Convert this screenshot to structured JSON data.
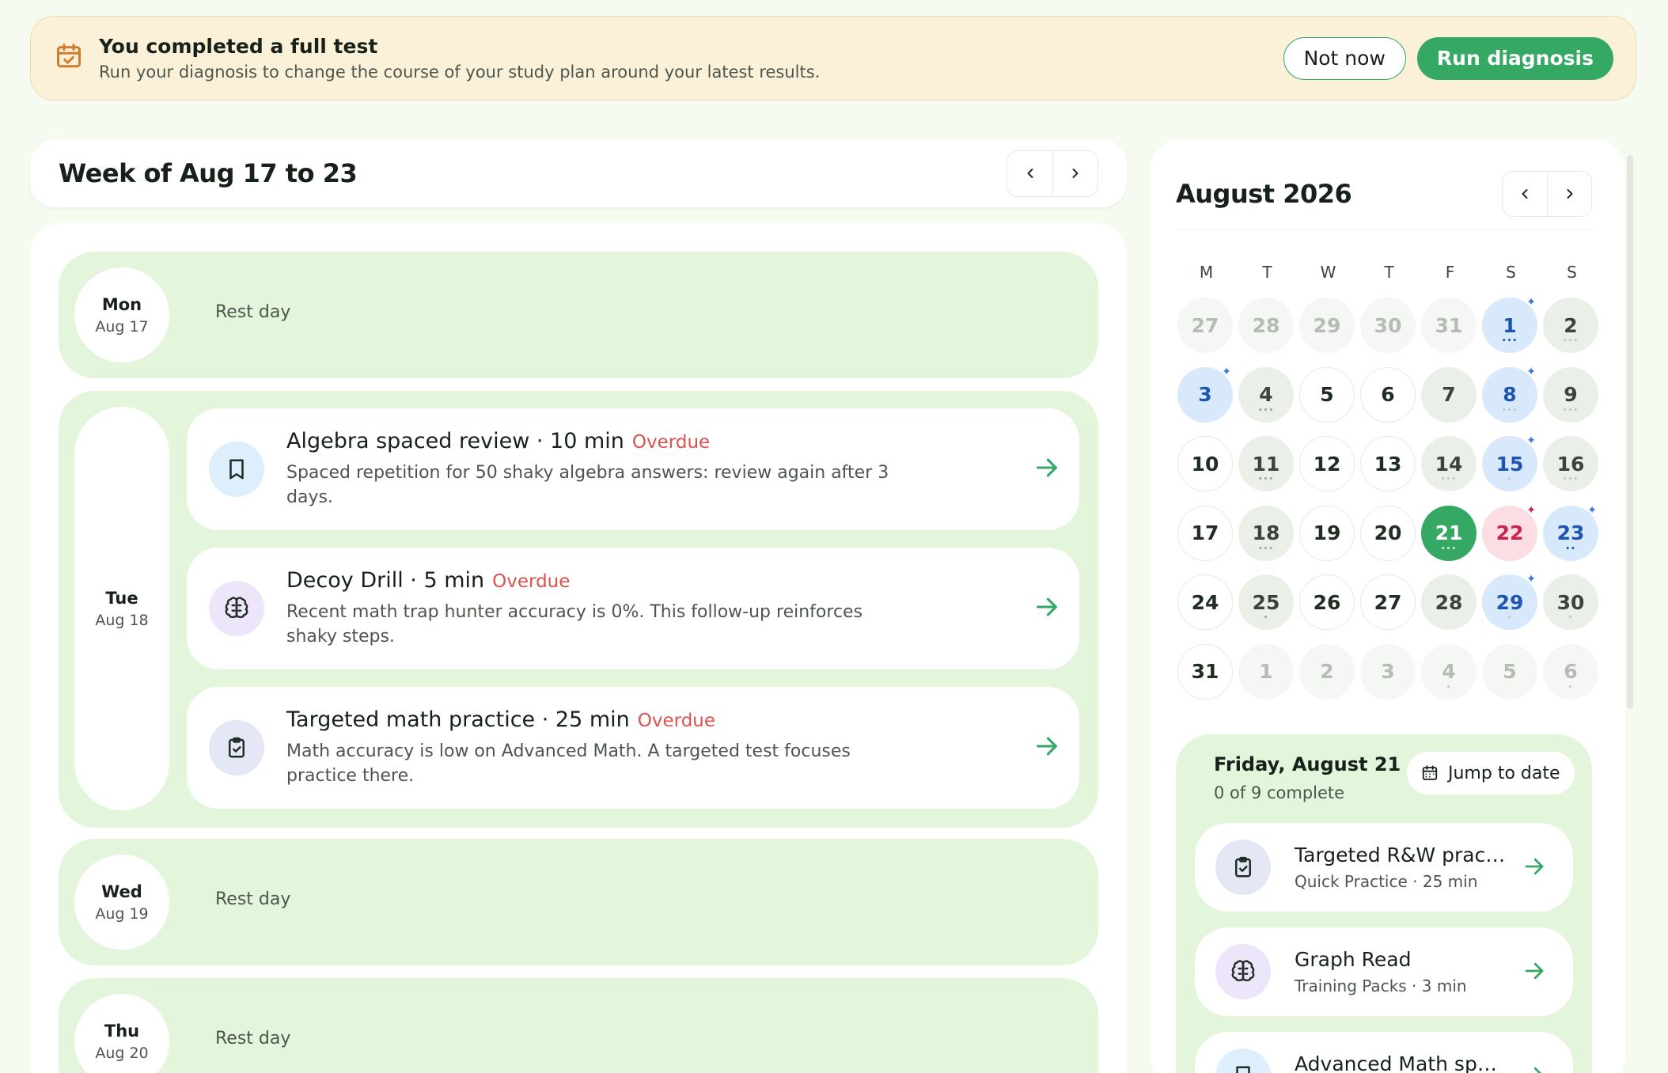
{
  "banner": {
    "title": "You completed a full test",
    "subtitle": "Run your diagnosis to change the course of your study plan around your latest results.",
    "not_now_label": "Not now",
    "run_label": "Run diagnosis",
    "icon": "calendar-check-icon",
    "accent": "#d07a2c"
  },
  "week": {
    "title": "Week of Aug 17 to 23",
    "days": [
      {
        "name": "Mon",
        "date": "Aug 17",
        "rest_label": "Rest day"
      },
      {
        "name": "Tue",
        "date": "Aug 18",
        "tasks": [
          {
            "title": "Algebra spaced review · 10 min",
            "status": "Overdue",
            "desc": "Spaced repetition for 50 shaky algebra answers: review again after 3 days.",
            "icon": "bookmark-icon"
          },
          {
            "title": "Decoy Drill · 5 min",
            "status": "Overdue",
            "desc": "Recent math trap hunter accuracy is 0%. This follow-up reinforces shaky steps.",
            "icon": "brain-icon"
          },
          {
            "title": "Targeted math practice · 25 min",
            "status": "Overdue",
            "desc": "Math accuracy is low on Advanced Math. A targeted test focuses practice there.",
            "icon": "clipboard-check-icon"
          }
        ]
      },
      {
        "name": "Wed",
        "date": "Aug 19",
        "rest_label": "Rest day"
      },
      {
        "name": "Thu",
        "date": "Aug 20",
        "rest_label": "Rest day"
      }
    ]
  },
  "calendar": {
    "title": "August 2026",
    "weekdays": [
      "M",
      "T",
      "W",
      "T",
      "F",
      "S",
      "S"
    ],
    "weeks": [
      [
        {
          "d": "27",
          "s": "muted"
        },
        {
          "d": "28",
          "s": "muted"
        },
        {
          "d": "29",
          "s": "muted"
        },
        {
          "d": "30",
          "s": "muted"
        },
        {
          "d": "31",
          "s": "muted"
        },
        {
          "d": "1",
          "s": "blue",
          "dots": "•••",
          "dc": "blue",
          "spark": true
        },
        {
          "d": "2",
          "s": "gray",
          "dots": "•••",
          "dc": "light"
        }
      ],
      [
        {
          "d": "3",
          "s": "blue",
          "spark": true
        },
        {
          "d": "4",
          "s": "gray",
          "dots": "•••",
          "dc": "gray"
        },
        {
          "d": "5",
          "s": "plain"
        },
        {
          "d": "6",
          "s": "plain"
        },
        {
          "d": "7",
          "s": "gray"
        },
        {
          "d": "8",
          "s": "blue",
          "dots": "•••",
          "dc": "light",
          "spark": true
        },
        {
          "d": "9",
          "s": "gray",
          "dots": "•••",
          "dc": "light"
        }
      ],
      [
        {
          "d": "10",
          "s": "plain"
        },
        {
          "d": "11",
          "s": "gray",
          "dots": "•••",
          "dc": "gray"
        },
        {
          "d": "12",
          "s": "plain"
        },
        {
          "d": "13",
          "s": "plain"
        },
        {
          "d": "14",
          "s": "gray",
          "dots": "•••",
          "dc": "light"
        },
        {
          "d": "15",
          "s": "blue",
          "dots": "•",
          "dc": "light",
          "spark": true
        },
        {
          "d": "16",
          "s": "gray",
          "dots": "•••",
          "dc": "light"
        }
      ],
      [
        {
          "d": "17",
          "s": "plain"
        },
        {
          "d": "18",
          "s": "gray",
          "dots": "•••",
          "dc": "gray"
        },
        {
          "d": "19",
          "s": "plain"
        },
        {
          "d": "20",
          "s": "plain"
        },
        {
          "d": "21",
          "s": "green",
          "dots": "•••",
          "dc": "white"
        },
        {
          "d": "22",
          "s": "pink",
          "spark": true,
          "sparkColor": "#c8224e"
        },
        {
          "d": "23",
          "s": "blue",
          "dots": "••",
          "dc": "blue",
          "spark": true
        }
      ],
      [
        {
          "d": "24",
          "s": "plain"
        },
        {
          "d": "25",
          "s": "gray",
          "dots": "•",
          "dc": "gray"
        },
        {
          "d": "26",
          "s": "plain"
        },
        {
          "d": "27",
          "s": "plain"
        },
        {
          "d": "28",
          "s": "gray"
        },
        {
          "d": "29",
          "s": "blue",
          "dots": "•",
          "dc": "light",
          "spark": true
        },
        {
          "d": "30",
          "s": "gray",
          "dots": "•",
          "dc": "light"
        }
      ],
      [
        {
          "d": "31",
          "s": "plain"
        },
        {
          "d": "1",
          "s": "muted"
        },
        {
          "d": "2",
          "s": "muted"
        },
        {
          "d": "3",
          "s": "muted"
        },
        {
          "d": "4",
          "s": "muted",
          "dots": "•",
          "dc": "light"
        },
        {
          "d": "5",
          "s": "muted"
        },
        {
          "d": "6",
          "s": "muted",
          "dots": "•",
          "dc": "light"
        }
      ]
    ]
  },
  "selected_day": {
    "title": "Friday, August 21",
    "progress": "0 of 9 complete",
    "jump_label": "Jump to date",
    "items": [
      {
        "title": "Targeted R&W practice",
        "meta": "Quick Practice · 25 min",
        "icon": "clipboard-check-icon"
      },
      {
        "title": "Graph Read",
        "meta": "Training Packs · 3 min",
        "icon": "brain-icon"
      },
      {
        "title": "Advanced Math spaced review",
        "meta": "",
        "icon": "bookmark-icon"
      }
    ]
  },
  "colors": {
    "accent_green": "#35a864",
    "overdue_red": "#d9534f",
    "day_bg": "#e3f5da"
  }
}
